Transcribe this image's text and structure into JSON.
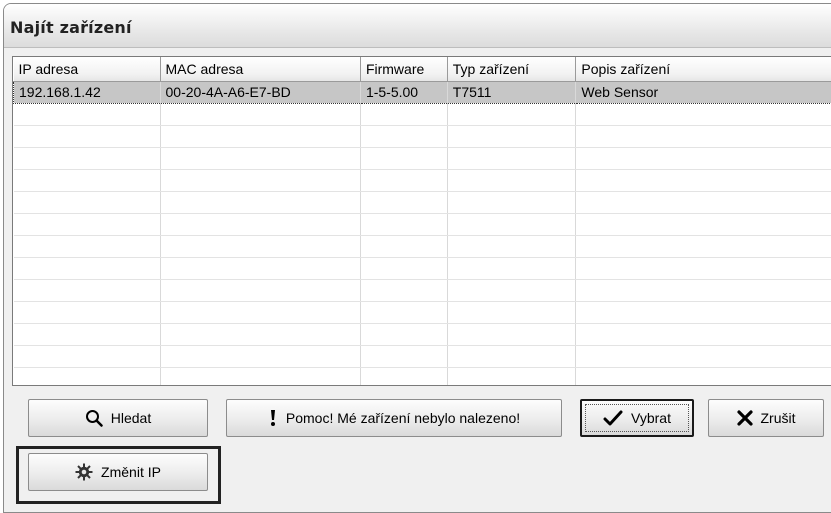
{
  "window": {
    "title": "Najít zařízení"
  },
  "table": {
    "columns": [
      "IP adresa",
      "MAC adresa",
      "Firmware",
      "Typ zařízení",
      "Popis zařízení"
    ],
    "rows": [
      {
        "ip": "192.168.1.42",
        "mac": "00-20-4A-A6-E7-BD",
        "firmware": "1-5-5.00",
        "type": "T7511",
        "description": "Web Sensor",
        "selected": true
      }
    ]
  },
  "buttons": {
    "search": "Hledat",
    "help": "Pomoc! Mé zařízení nebylo nalezeno!",
    "select": "Vybrat",
    "cancel": "Zrušit",
    "change_ip": "Změnit IP"
  },
  "icons": {
    "search": "magnifier-icon",
    "help": "exclamation-icon",
    "select": "checkmark-icon",
    "cancel": "x-cross-icon",
    "change_ip": "gear-icon"
  }
}
